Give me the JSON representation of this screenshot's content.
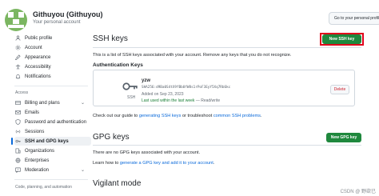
{
  "header": {
    "user_name": "Githuyou (Githuyou)",
    "user_subtitle": "Your personal account",
    "profile_button": "Go to your personal profile"
  },
  "sidebar": {
    "items_top": [
      {
        "label": "Public profile",
        "icon": "person-icon"
      },
      {
        "label": "Account",
        "icon": "gear-icon"
      },
      {
        "label": "Appearance",
        "icon": "paintbrush-icon"
      },
      {
        "label": "Accessibility",
        "icon": "accessibility-icon"
      },
      {
        "label": "Notifications",
        "icon": "bell-icon"
      }
    ],
    "access_label": "Access",
    "items_access": [
      {
        "label": "Billing and plans",
        "icon": "credit-card-icon",
        "expandable": true
      },
      {
        "label": "Emails",
        "icon": "mail-icon"
      },
      {
        "label": "Password and authentication",
        "icon": "shield-lock-icon"
      },
      {
        "label": "Sessions",
        "icon": "broadcast-icon"
      },
      {
        "label": "SSH and GPG keys",
        "icon": "key-icon",
        "active": true
      },
      {
        "label": "Organizations",
        "icon": "organization-icon"
      },
      {
        "label": "Enterprises",
        "icon": "globe-icon"
      },
      {
        "label": "Moderation",
        "icon": "report-icon",
        "expandable": true
      }
    ],
    "code_label": "Code, planning, and automation"
  },
  "ssh": {
    "title": "SSH keys",
    "new_button": "New SSH key",
    "description": "This is a list of SSH keys associated with your account. Remove any keys that you do not recognize.",
    "auth_title": "Authentication Keys",
    "key": {
      "name": "yzw",
      "type": "SSH",
      "fingerprint": "SHA256:d9Ba0S4tX9fBb0fW8s1rPoF3EyY5Xq7Rb6kc",
      "added": "Added on Sep 23, 2023",
      "last_used": "Last used within the last week",
      "access": " — Read/write",
      "delete_label": "Delete"
    },
    "guide_prefix": "Check out our guide to ",
    "guide_link1": "generating SSH keys",
    "guide_middle": " or troubleshoot ",
    "guide_link2": "common SSH problems",
    "guide_suffix": "."
  },
  "gpg": {
    "title": "GPG keys",
    "new_button": "New GPG key",
    "empty_text": "There are no GPG keys associated with your account.",
    "learn_prefix": "Learn how to ",
    "learn_link": "generate a GPG key and add it to your account",
    "learn_suffix": "."
  },
  "vigilant": {
    "title": "Vigilant mode"
  },
  "watermark": "CSDN @ 野欲已"
}
